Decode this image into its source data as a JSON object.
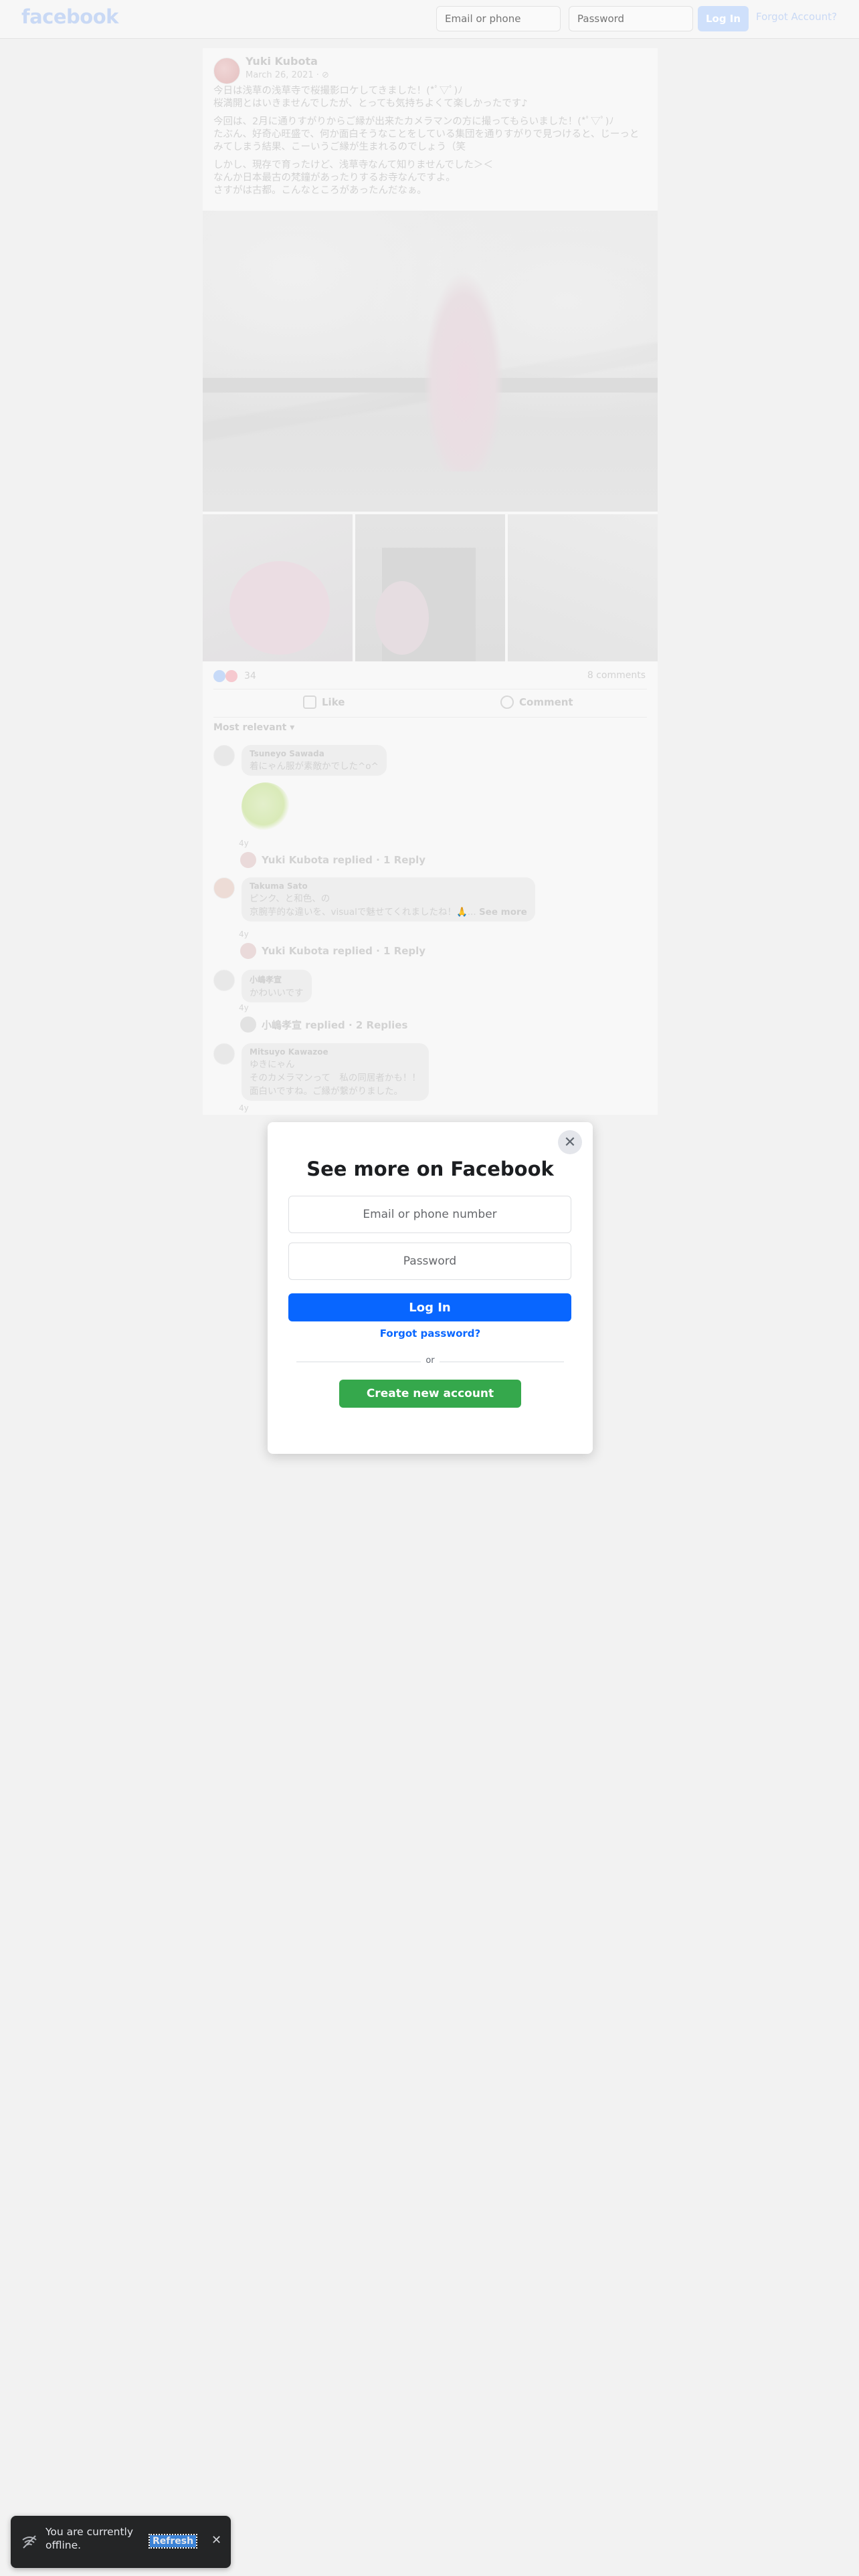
{
  "header": {
    "logo": "facebook",
    "email_placeholder": "Email or phone",
    "password_placeholder": "Password",
    "login_label": "Log In",
    "forgot_label": "Forgot Account?"
  },
  "post": {
    "author": "Yuki Kubota",
    "date": "March 26, 2021 · ⊘",
    "text_lines_1": [
      "今日は浅草の浅草寺で桜撮影ロケしてきました！(*ﾟ▽ﾟ)ﾉ",
      "桜満開とはいきませんでしたが、とっても気持ちよくて楽しかったです♪"
    ],
    "text_lines_2": [
      "今回は、2月に通りすがりからご縁が出来たカメラマンの方に撮ってもらいました！(*ﾟ▽ﾟ)ﾉ",
      "たぶん、好奇心旺盛で、何か面白そうなことをしている集団を通りすがりで見つけると、じーっとみてしまう結果、こーいうご縁が生まれるのでしょう（笑"
    ],
    "text_lines_3": [
      "しかし、現存で育ったけど、浅草寺なんて知りませんでした＞＜",
      "なんか日本最古の梵鐘があったりするお寺なんですよ。",
      "さすがは古都。こんなところがあったんだなぁ。"
    ],
    "reaction_count": "34",
    "comments_count": "8 comments",
    "like_label": "Like",
    "comment_label": "Comment",
    "relevant_label": "Most relevant ▾"
  },
  "comments": [
    {
      "name": "Tsuneyo Sawada",
      "text": "着にゃん服が素敵かでした^o^",
      "time": "4y",
      "reply": "Yuki Kubota replied · 1 Reply"
    },
    {
      "name": "Takuma Sato",
      "text": "ピンク、と和色、の",
      "text2": "京腕芋的な違いを、visualで魅せてくれましたね！🙏...",
      "see_more": "See more",
      "time": "4y",
      "reply": "Yuki Kubota replied · 1 Reply"
    },
    {
      "name": "小嶋孝宣",
      "text": "かわいいです",
      "time": "4y",
      "reply": "小嶋孝宣 replied · 2 Replies"
    },
    {
      "name": "Mitsuyo Kawazoe",
      "text": "ゆきにゃん",
      "text2": "そのカメラマンって　私の同居者かも！！",
      "text3": "面白いですね。ご縁が繋がりました。",
      "time": "4y"
    }
  ],
  "modal": {
    "title": "See more on Facebook",
    "email_placeholder": "Email or phone number",
    "password_placeholder": "Password",
    "login_label": "Log In",
    "forgot_label": "Forgot password?",
    "or_label": "or",
    "create_label": "Create new account",
    "close_icon": "✕"
  },
  "toast": {
    "message": "You are currently offline.",
    "refresh_label": "Refresh",
    "close_icon": "✕"
  }
}
